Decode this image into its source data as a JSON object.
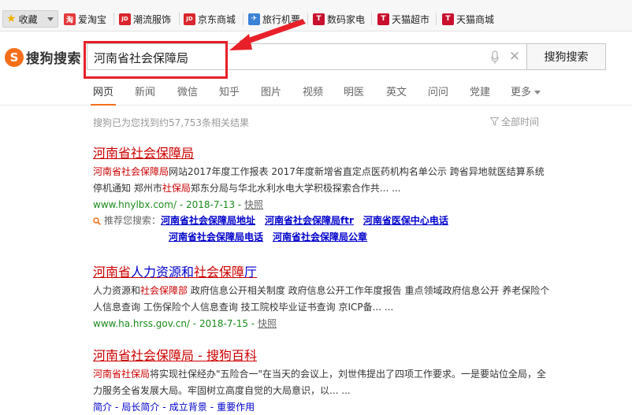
{
  "bookmarks": {
    "favorites": "收藏",
    "items": [
      {
        "label": "爱淘宝",
        "icon": "taobao-icon",
        "color": "#e4393c",
        "glyph": "淘"
      },
      {
        "label": "潮流服饰",
        "icon": "jd-icon",
        "color": "#d8262c",
        "glyph": "JD"
      },
      {
        "label": "京东商城",
        "icon": "jd-icon",
        "color": "#d8262c",
        "glyph": "JD"
      },
      {
        "label": "旅行机票",
        "icon": "travel-icon",
        "color": "#3b82d6",
        "glyph": "✈"
      },
      {
        "label": "数码家电",
        "icon": "tmall-icon",
        "color": "#c8102e",
        "glyph": "T"
      },
      {
        "label": "天猫超市",
        "icon": "tmall-icon",
        "color": "#c8102e",
        "glyph": "T"
      },
      {
        "label": "天猫商城",
        "icon": "tmall-icon",
        "color": "#c8102e",
        "glyph": "T"
      }
    ]
  },
  "logo": {
    "mark": "S",
    "text": "搜狗搜索"
  },
  "search": {
    "value": "河南省社会保障局",
    "button": "搜狗搜索"
  },
  "tabs": {
    "web": "网页",
    "news": "新闻",
    "weixin": "微信",
    "zhihu": "知乎",
    "images": "图片",
    "video": "视频",
    "mingyi": "明医",
    "english": "英文",
    "wenwen": "问问",
    "party": "党建",
    "more": "更多"
  },
  "results_meta": {
    "count_text": "搜狗已为您找到约57,753条相关结果",
    "time_filter": "全部时间"
  },
  "results": [
    {
      "title": "河南省社会保障局",
      "snippet_red1": "河南省社会保障局",
      "snippet_a": "网站2017年度工作报表 2017年度新增省直定点医药机构名单公示 跨省异地就医结算系统停机通知 郑州市",
      "snippet_red2": "社保局",
      "snippet_b": "郑东分局与华北水利水电大学积极探索合作共... ...",
      "url": "www.hnylbx.com/",
      "date": " - 2018-7-13 - ",
      "snapshot": "快照",
      "recommend_label": "推荐您搜索：",
      "recommend": [
        "河南省社会保障局地址",
        "河南省社会保障局ftr",
        "河南省医保中心电话",
        "河南省社会保障局电话",
        "河南省社会保障局公章"
      ]
    },
    {
      "title_a": "河南省",
      "title_b": "人力资源和",
      "title_c": "社会保障",
      "title_d": "厅",
      "snippet_a": "人力资源和",
      "snippet_red": "社会保障部",
      "snippet_b": " 政府信息公开相关制度 政府信息公开工作年度报告 重点领域政府信息公开 养老保险个人信息查询 工伤保险个人信息查询 技工院校毕业证书查询 京ICP备... ...",
      "url": "www.ha.hrss.gov.cn/",
      "date": " - 2018-7-15 - ",
      "snapshot": "快照"
    },
    {
      "title_a": "河南省社会保障局",
      "title_b": " - 搜狗百科",
      "snippet_red1": "河南省社保局",
      "snippet_a": "将实现社保经办\"五险合一\"在当天的会议上，刘世伟提出了四项工作要求。一是要站位全局，全力服务全省发展大局。牢固树立高度自觉的大局意识，以... ...",
      "sublinks": [
        "简介",
        "局长简介",
        "成立背景",
        "重要作用"
      ]
    }
  ]
}
